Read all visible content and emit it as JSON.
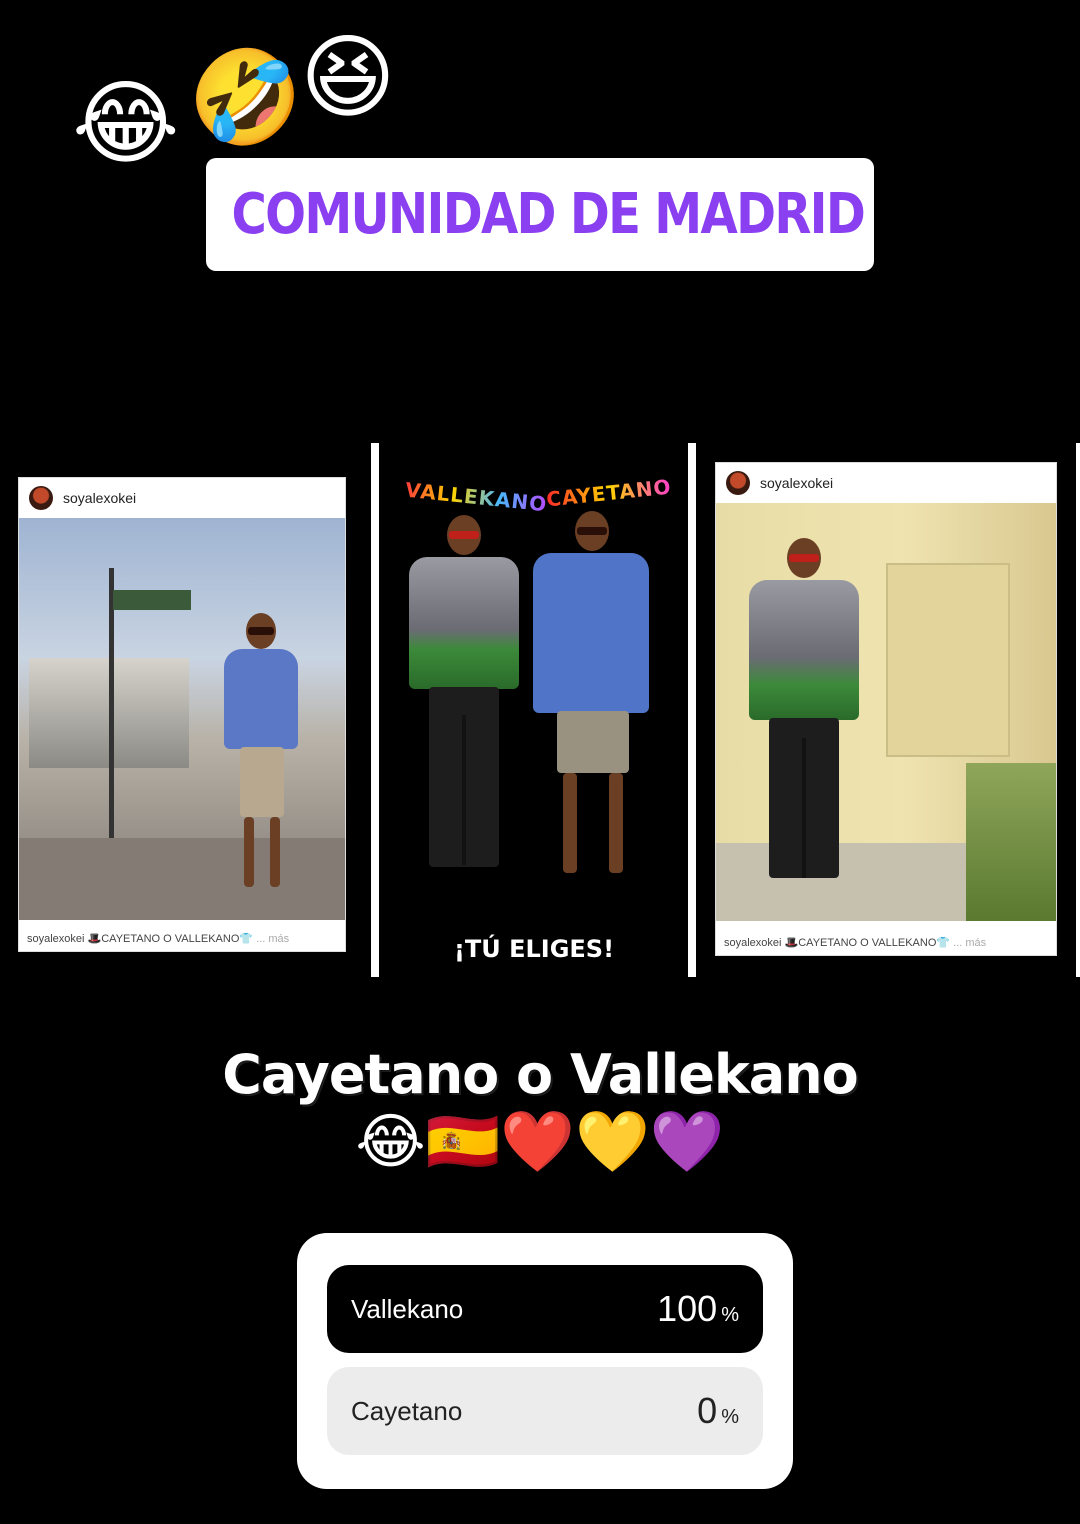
{
  "top_emojis": [
    "😂",
    "🤣",
    "😆"
  ],
  "location": {
    "text": "COMUNIDAD DE MADRID",
    "color": "#8a3ff0",
    "icon": "map-pin-icon"
  },
  "collage": {
    "left_post": {
      "username": "soyalexokei",
      "caption": "soyalexokei 🎩CAYETANO O VALLEKANO👕",
      "more": "... más"
    },
    "center": {
      "label_left": "VALLEKANO",
      "label_right": "CAYETANO",
      "footer": "¡TÚ ELIGES!"
    },
    "right_post": {
      "username": "soyalexokei",
      "caption": "soyalexokei 🎩CAYETANO O VALLEKANO👕",
      "more": "... más"
    }
  },
  "caption": {
    "title": "Cayetano o Vallekano",
    "emojis": "😂🇪🇸❤️💛💜"
  },
  "poll": {
    "options": [
      {
        "label": "Vallekano",
        "percent": "100",
        "sign": "%",
        "selected": true
      },
      {
        "label": "Cayetano",
        "percent": "0",
        "sign": "%",
        "selected": false
      }
    ]
  }
}
